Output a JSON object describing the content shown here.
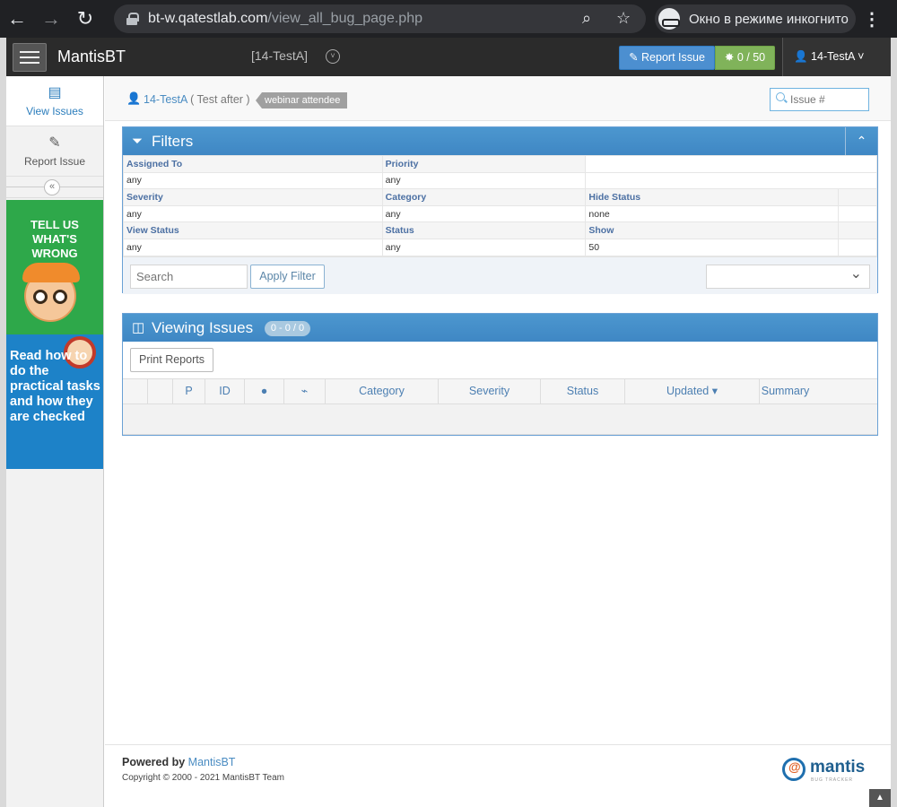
{
  "browser": {
    "url_host": "bt-w.qatestlab.com",
    "url_path": "/view_all_bug_page.php",
    "incognito_label": "Окно в режиме инкогнито"
  },
  "navbar": {
    "brand": "MantisBT",
    "project": "[14-TestA]",
    "report_issue": "Report Issue",
    "issue_count": "0 / 50",
    "user": "14-TestA"
  },
  "sidebar": {
    "items": [
      {
        "label": "View Issues",
        "icon": "list-icon"
      },
      {
        "label": "Report Issue",
        "icon": "edit-icon"
      }
    ],
    "ad_green_text": "TELL US WHAT'S WRONG",
    "ad_blue_text": "Read how to do the practical tasks and how they are checked"
  },
  "breadcrumb": {
    "username": "14-TestA",
    "realname": "( Test after )",
    "role": "webinar attendee",
    "issue_placeholder": "Issue #"
  },
  "filters": {
    "title": "Filters",
    "rows": [
      [
        {
          "label": "Assigned To",
          "value": "any"
        },
        {
          "label": "Priority",
          "value": "any"
        },
        {
          "label": "",
          "value": ""
        }
      ],
      [
        {
          "label": "Severity",
          "value": "any"
        },
        {
          "label": "Category",
          "value": "any"
        },
        {
          "label": "Hide Status",
          "value": "none"
        }
      ],
      [
        {
          "label": "View Status",
          "value": "any"
        },
        {
          "label": "Status",
          "value": "any"
        },
        {
          "label": "Show",
          "value": "50"
        }
      ]
    ],
    "search_placeholder": "Search",
    "apply_label": "Apply Filter"
  },
  "issues": {
    "title": "Viewing Issues",
    "count": "0 - 0 / 0",
    "print_label": "Print Reports",
    "columns": [
      "",
      "",
      "P",
      "ID",
      "",
      "",
      "Category",
      "Severity",
      "Status",
      "Updated ▾",
      "Summary"
    ]
  },
  "footer": {
    "powered_label": "Powered by",
    "powered_link": "MantisBT",
    "copyright": "Copyright © 2000 - 2021 MantisBT Team",
    "logo_word": "mantis",
    "logo_tag": "BUG TRACKER"
  },
  "colors": {
    "header_blue": "#438eb9",
    "navbar": "#2b2b2b",
    "report_button": "#4c8fd0",
    "count_button": "#80b35a"
  }
}
